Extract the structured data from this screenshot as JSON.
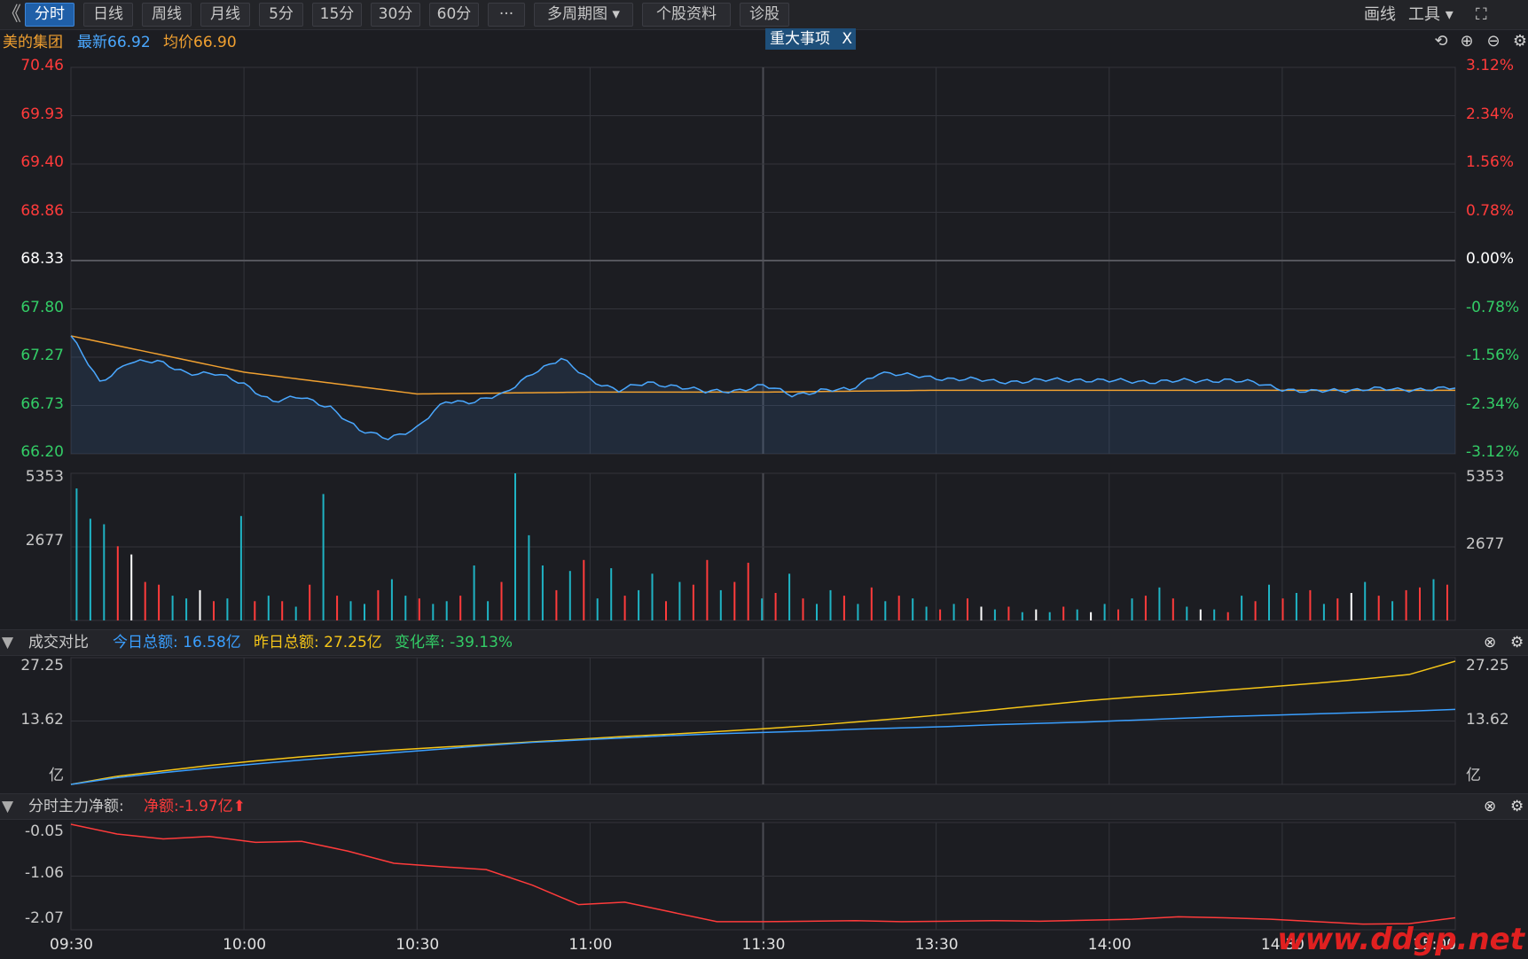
{
  "toolbar": {
    "back_arrow": "《",
    "tabs": [
      "分时",
      "日线",
      "周线",
      "月线",
      "5分",
      "15分",
      "30分",
      "60分",
      "···",
      "多周期图 ▾",
      "个股资料",
      "诊股"
    ],
    "active_tab": "分时",
    "draw_label": "画线",
    "tools_label": "工具 ▾",
    "fullscreen_icon": "expand-icon"
  },
  "quote": {
    "stock_name": "美的集团",
    "latest_label": "最新66.92",
    "avg_label": "均价66.90",
    "events_tab": "重大事项",
    "events_close": "X"
  },
  "colors": {
    "price_line": "#4aa8ff",
    "avg_line": "#f0a030",
    "up": "#ff3b3b",
    "down": "#33cc66",
    "neutral": "#ffffff",
    "volume_cyan": "#1fb3c4",
    "today_amount": "#3a9fff",
    "yesterday_amount": "#f5c518",
    "net_flow": "#ff3b3b"
  },
  "price_axis": {
    "left": [
      "70.46",
      "69.93",
      "69.40",
      "68.86",
      "68.33",
      "67.80",
      "67.27",
      "66.73",
      "66.20"
    ],
    "right": [
      "3.12%",
      "2.34%",
      "1.56%",
      "0.78%",
      "0.00%",
      "-0.78%",
      "-1.56%",
      "-2.34%",
      "-3.12%"
    ]
  },
  "volume_axis": {
    "left": [
      "5353",
      "2677"
    ],
    "right": [
      "5353",
      "2677"
    ]
  },
  "turnover_panel": {
    "title": "成交对比",
    "today_label": "今日总额: 16.58亿",
    "yesterday_label": "昨日总额: 27.25亿",
    "change_label": "变化率: -39.13%",
    "axis_left": [
      "27.25",
      "13.62",
      "亿"
    ],
    "axis_right": [
      "27.25",
      "13.62",
      "亿"
    ]
  },
  "netflow_panel": {
    "title": "分时主力净额:",
    "net_label": "净额:-1.97亿",
    "arrow": "⬆",
    "axis_left": [
      "-0.05",
      "-1.06",
      "-2.07"
    ]
  },
  "time_axis": [
    "09:30",
    "10:00",
    "10:30",
    "11:00",
    "11:30",
    "13:30",
    "14:00",
    "14:30",
    "15:00"
  ],
  "watermark": "www.ddgp.net",
  "chart_data": [
    {
      "type": "line",
      "title": "",
      "xlabel": "",
      "ylabel": "",
      "ylim": [
        66.2,
        70.46
      ],
      "series": [
        {
          "name": "最新",
          "x": [
            "09:30",
            "09:35",
            "09:40",
            "09:45",
            "09:50",
            "09:55",
            "10:00",
            "10:05",
            "10:10",
            "10:15",
            "10:20",
            "10:25",
            "10:30",
            "10:35",
            "10:40",
            "10:45",
            "10:50",
            "10:55",
            "11:00",
            "11:05",
            "11:10",
            "11:15",
            "11:20",
            "11:25",
            "11:30",
            "13:05",
            "13:10",
            "13:15",
            "13:20",
            "13:25",
            "13:30",
            "13:35",
            "13:40",
            "13:45",
            "13:50",
            "13:55",
            "14:00",
            "14:05",
            "14:10",
            "14:15",
            "14:20",
            "14:25",
            "14:30",
            "14:35",
            "14:40",
            "14:45",
            "14:50",
            "14:55",
            "15:00"
          ],
          "values": [
            67.5,
            66.98,
            67.22,
            67.21,
            67.1,
            67.08,
            66.97,
            66.78,
            66.82,
            66.72,
            66.45,
            66.38,
            66.48,
            66.78,
            66.78,
            66.85,
            67.1,
            67.24,
            67.02,
            66.9,
            66.98,
            66.95,
            66.88,
            66.9,
            66.95,
            66.85,
            66.9,
            66.9,
            67.1,
            67.06,
            67.04,
            67.02,
            67.0,
            67.0,
            67.01,
            67.02,
            67.0,
            67.0,
            67.0,
            67.0,
            67.02,
            66.98,
            66.92,
            66.88,
            66.9,
            66.92,
            66.9,
            66.92,
            66.92
          ]
        },
        {
          "name": "均价",
          "x": [
            "09:30",
            "10:00",
            "10:30",
            "11:00",
            "11:30",
            "13:30",
            "14:00",
            "14:30",
            "15:00"
          ],
          "values": [
            67.5,
            67.1,
            66.86,
            66.88,
            66.88,
            66.9,
            66.9,
            66.9,
            66.9
          ]
        }
      ]
    },
    {
      "type": "bar",
      "title": "",
      "ylim": [
        0,
        5353
      ],
      "values_note_units": "手",
      "values": [
        4800,
        3700,
        3500,
        2700,
        2400,
        1400,
        1300,
        900,
        800,
        1100,
        700,
        800,
        3800,
        700,
        900,
        700,
        500,
        1300,
        4600,
        900,
        700,
        600,
        1100,
        1500,
        900,
        800,
        600,
        700,
        900,
        2000,
        700,
        1400,
        5353,
        3100,
        2000,
        1100,
        1800,
        2200,
        800,
        1900,
        900,
        1100,
        1700,
        700,
        1400,
        1300,
        2200,
        1100,
        1400,
        2100,
        800,
        1000,
        1700,
        800,
        600,
        1100,
        900,
        600,
        1200,
        700,
        900,
        800,
        500,
        400,
        600,
        800,
        500,
        400,
        500,
        300,
        400,
        300,
        500,
        400,
        300,
        600,
        400,
        800,
        900,
        1200,
        800,
        500,
        400,
        400,
        300,
        900,
        700,
        1300,
        800,
        1000,
        1100,
        600,
        800,
        1000,
        1400,
        900,
        700,
        1100,
        1200,
        1500,
        1300
      ],
      "colors": [
        "#1fb3c4",
        "#1fb3c4",
        "#1fb3c4",
        "#ff3b3b",
        "#ffffff",
        "#ff3b3b",
        "#ff3b3b",
        "#1fb3c4",
        "#1fb3c4",
        "#ffffff",
        "#ff3b3b",
        "#1fb3c4",
        "#1fb3c4",
        "#ff3b3b",
        "#1fb3c4",
        "#ff3b3b",
        "#1fb3c4",
        "#ff3b3b",
        "#1fb3c4",
        "#ff3b3b",
        "#1fb3c4",
        "#1fb3c4",
        "#ff3b3b",
        "#1fb3c4",
        "#1fb3c4",
        "#ff3b3b",
        "#1fb3c4",
        "#1fb3c4",
        "#ff3b3b",
        "#1fb3c4",
        "#1fb3c4",
        "#ff3b3b",
        "#1fb3c4",
        "#1fb3c4",
        "#1fb3c4",
        "#ff3b3b",
        "#1fb3c4",
        "#ff3b3b",
        "#1fb3c4",
        "#1fb3c4",
        "#ff3b3b",
        "#1fb3c4",
        "#1fb3c4",
        "#ff3b3b",
        "#1fb3c4",
        "#ff3b3b",
        "#ff3b3b",
        "#1fb3c4",
        "#ff3b3b",
        "#ff3b3b",
        "#1fb3c4",
        "#ff3b3b",
        "#1fb3c4",
        "#ff3b3b",
        "#1fb3c4",
        "#1fb3c4",
        "#ff3b3b",
        "#1fb3c4",
        "#ff3b3b",
        "#1fb3c4",
        "#ff3b3b",
        "#1fb3c4",
        "#1fb3c4",
        "#ff3b3b",
        "#1fb3c4",
        "#ff3b3b",
        "#ffffff",
        "#1fb3c4",
        "#ff3b3b",
        "#1fb3c4",
        "#ffffff",
        "#1fb3c4",
        "#ff3b3b",
        "#1fb3c4",
        "#ffffff",
        "#1fb3c4",
        "#ff3b3b",
        "#1fb3c4",
        "#ff3b3b",
        "#1fb3c4",
        "#ff3b3b",
        "#1fb3c4",
        "#ffffff",
        "#1fb3c4",
        "#ff3b3b",
        "#1fb3c4",
        "#ff3b3b",
        "#1fb3c4",
        "#ff3b3b",
        "#1fb3c4",
        "#ff3b3b",
        "#1fb3c4",
        "#ff3b3b",
        "#ffffff",
        "#1fb3c4",
        "#ff3b3b",
        "#1fb3c4",
        "#ff3b3b",
        "#ff3b3b",
        "#1fb3c4",
        "#ff3b3b"
      ]
    },
    {
      "type": "line",
      "title": "",
      "ylim": [
        0,
        27.25
      ],
      "series": [
        {
          "name": "今日总额",
          "values": [
            0,
            1.5,
            2.6,
            3.6,
            4.5,
            5.4,
            6.2,
            7.0,
            7.8,
            8.6,
            9.3,
            9.8,
            10.3,
            10.8,
            11.2,
            11.5,
            11.8,
            12.2,
            12.5,
            12.8,
            13.2,
            13.5,
            13.8,
            14.2,
            14.6,
            15.0,
            15.3,
            15.6,
            15.9,
            16.2,
            16.58
          ]
        },
        {
          "name": "昨日总额",
          "values": [
            0,
            1.8,
            3.0,
            4.2,
            5.2,
            6.1,
            6.9,
            7.6,
            8.2,
            8.8,
            9.4,
            10.0,
            10.6,
            11.1,
            11.7,
            12.3,
            13.0,
            13.8,
            14.6,
            15.5,
            16.5,
            17.5,
            18.5,
            19.3,
            20.0,
            20.8,
            21.6,
            22.4,
            23.3,
            24.3,
            27.25
          ]
        }
      ]
    },
    {
      "type": "line",
      "title": "",
      "ylim": [
        -2.07,
        -0.05
      ],
      "series": [
        {
          "name": "净额",
          "values": [
            -0.05,
            -0.25,
            -0.35,
            -0.3,
            -0.42,
            -0.4,
            -0.6,
            -0.85,
            -0.92,
            -0.98,
            -1.3,
            -1.7,
            -1.65,
            -1.85,
            -2.05,
            -2.05,
            -2.04,
            -2.03,
            -2.05,
            -2.04,
            -2.03,
            -2.04,
            -2.02,
            -2.0,
            -1.95,
            -1.97,
            -2.0,
            -2.05,
            -2.1,
            -2.09,
            -1.97
          ]
        }
      ]
    }
  ]
}
